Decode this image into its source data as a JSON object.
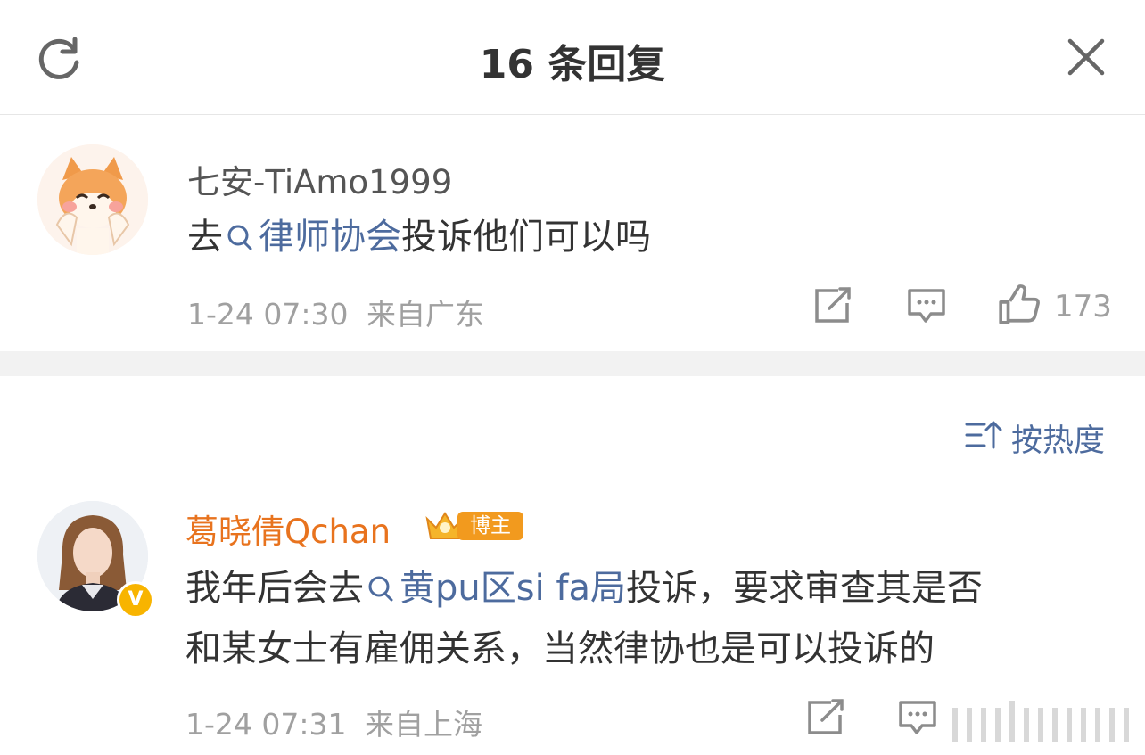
{
  "header": {
    "title": "16 条回复",
    "refresh_icon": "refresh-icon",
    "close_icon": "close-icon"
  },
  "root_comment": {
    "username": "七安-TiAmo1999",
    "text_before": "去",
    "topic_link": "律师协会",
    "text_after": "投诉他们可以吗",
    "timestamp": "1-24 07:30",
    "location": "来自广东",
    "like_count": "173",
    "icons": [
      "share-icon",
      "comment-icon",
      "like-icon"
    ]
  },
  "sort": {
    "label": "按热度",
    "icon": "sort-icon"
  },
  "reply": {
    "username": "葛晓倩Qchan",
    "badge_label": "博主",
    "line1_before": "我年后会去",
    "topic_link": "黄pu区si fa局",
    "line1_after": "投诉，要求审查其是否",
    "line2": "和某女士有雇佣关系，当然律协也是可以投诉的",
    "timestamp": "1-24 07:31",
    "location": "来自上海",
    "verified_mark": "V",
    "icons": [
      "share-icon",
      "comment-icon"
    ]
  },
  "colors": {
    "link": "#4d6b9e",
    "username_orange": "#e8731e",
    "badge_orange": "#f29a1e",
    "meta_gray": "#a0a0a0",
    "separator": "#f2f2f2"
  }
}
